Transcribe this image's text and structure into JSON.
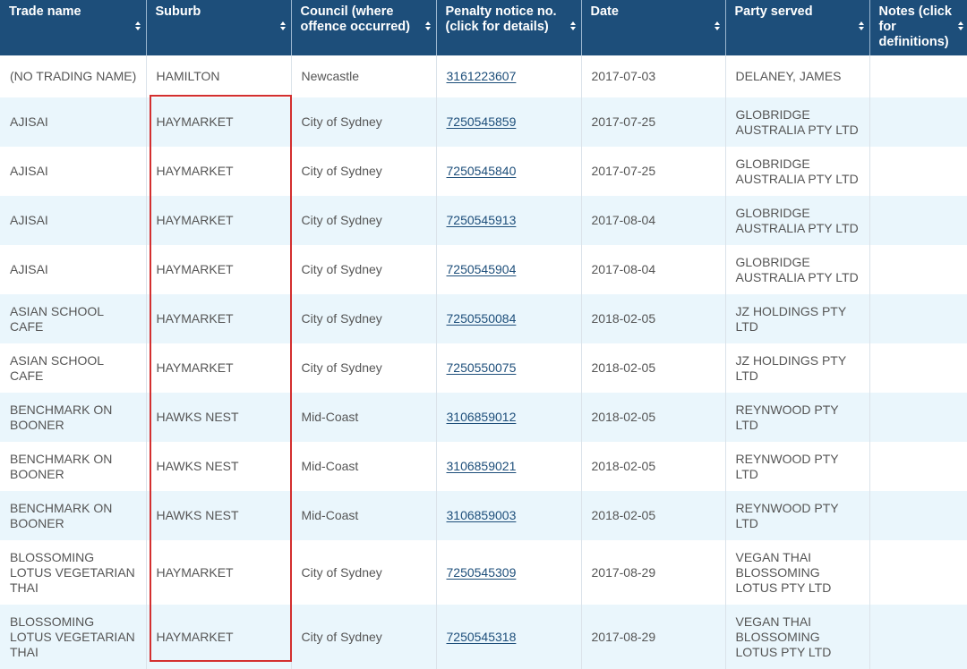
{
  "table": {
    "headers": [
      {
        "label": "Trade name",
        "name": "header-trade-name"
      },
      {
        "label": "Suburb",
        "name": "header-suburb"
      },
      {
        "label": "Council (where offence occurred)",
        "name": "header-council"
      },
      {
        "label": "Penalty notice no. (click for details)",
        "name": "header-penalty-notice"
      },
      {
        "label": "Date",
        "name": "header-date"
      },
      {
        "label": "Party served",
        "name": "header-party-served"
      },
      {
        "label": "Notes (click for definitions)",
        "name": "header-notes"
      }
    ],
    "rows": [
      {
        "trade": "(NO TRADING NAME)",
        "suburb": "HAMILTON",
        "council": "Newcastle",
        "notice": "3161223607",
        "date": "2017-07-03",
        "party": "DELANEY, JAMES",
        "notes": ""
      },
      {
        "trade": "AJISAI",
        "suburb": "HAYMARKET",
        "council": "City of Sydney",
        "notice": "7250545859",
        "date": "2017-07-25",
        "party": "GLOBRIDGE AUSTRALIA PTY LTD",
        "notes": ""
      },
      {
        "trade": "AJISAI",
        "suburb": "HAYMARKET",
        "council": "City of Sydney",
        "notice": "7250545840",
        "date": "2017-07-25",
        "party": "GLOBRIDGE AUSTRALIA PTY LTD",
        "notes": ""
      },
      {
        "trade": "AJISAI",
        "suburb": "HAYMARKET",
        "council": "City of Sydney",
        "notice": "7250545913",
        "date": "2017-08-04",
        "party": "GLOBRIDGE AUSTRALIA PTY LTD",
        "notes": ""
      },
      {
        "trade": "AJISAI",
        "suburb": "HAYMARKET",
        "council": "City of Sydney",
        "notice": "7250545904",
        "date": "2017-08-04",
        "party": "GLOBRIDGE AUSTRALIA PTY LTD",
        "notes": ""
      },
      {
        "trade": "ASIAN SCHOOL CAFE",
        "suburb": "HAYMARKET",
        "council": "City of Sydney",
        "notice": "7250550084",
        "date": "2018-02-05",
        "party": "JZ HOLDINGS PTY LTD",
        "notes": ""
      },
      {
        "trade": "ASIAN SCHOOL CAFE",
        "suburb": "HAYMARKET",
        "council": "City of Sydney",
        "notice": "7250550075",
        "date": "2018-02-05",
        "party": "JZ HOLDINGS PTY LTD",
        "notes": ""
      },
      {
        "trade": "BENCHMARK ON BOONER",
        "suburb": "HAWKS NEST",
        "council": "Mid-Coast",
        "notice": "3106859012",
        "date": "2018-02-05",
        "party": "REYNWOOD PTY LTD",
        "notes": ""
      },
      {
        "trade": "BENCHMARK ON BOONER",
        "suburb": "HAWKS NEST",
        "council": "Mid-Coast",
        "notice": "3106859021",
        "date": "2018-02-05",
        "party": "REYNWOOD PTY LTD",
        "notes": ""
      },
      {
        "trade": "BENCHMARK ON BOONER",
        "suburb": "HAWKS NEST",
        "council": "Mid-Coast",
        "notice": "3106859003",
        "date": "2018-02-05",
        "party": "REYNWOOD PTY LTD",
        "notes": ""
      },
      {
        "trade": "BLOSSOMING LOTUS VEGETARIAN THAI",
        "suburb": "HAYMARKET",
        "council": "City of Sydney",
        "notice": "7250545309",
        "date": "2017-08-29",
        "party": "VEGAN THAI BLOSSOMING LOTUS PTY LTD",
        "notes": ""
      },
      {
        "trade": "BLOSSOMING LOTUS VEGETARIAN THAI",
        "suburb": "HAYMARKET",
        "council": "City of Sydney",
        "notice": "7250545318",
        "date": "2017-08-29",
        "party": "VEGAN THAI BLOSSOMING LOTUS PTY LTD",
        "notes": ""
      }
    ]
  },
  "colors": {
    "header_bg": "#1d4e7a",
    "row_alt_bg": "#eaf6fc",
    "link": "#1d4e7a",
    "highlight_border": "#d32f2f"
  },
  "icons": {
    "sort": "sort-icon"
  }
}
